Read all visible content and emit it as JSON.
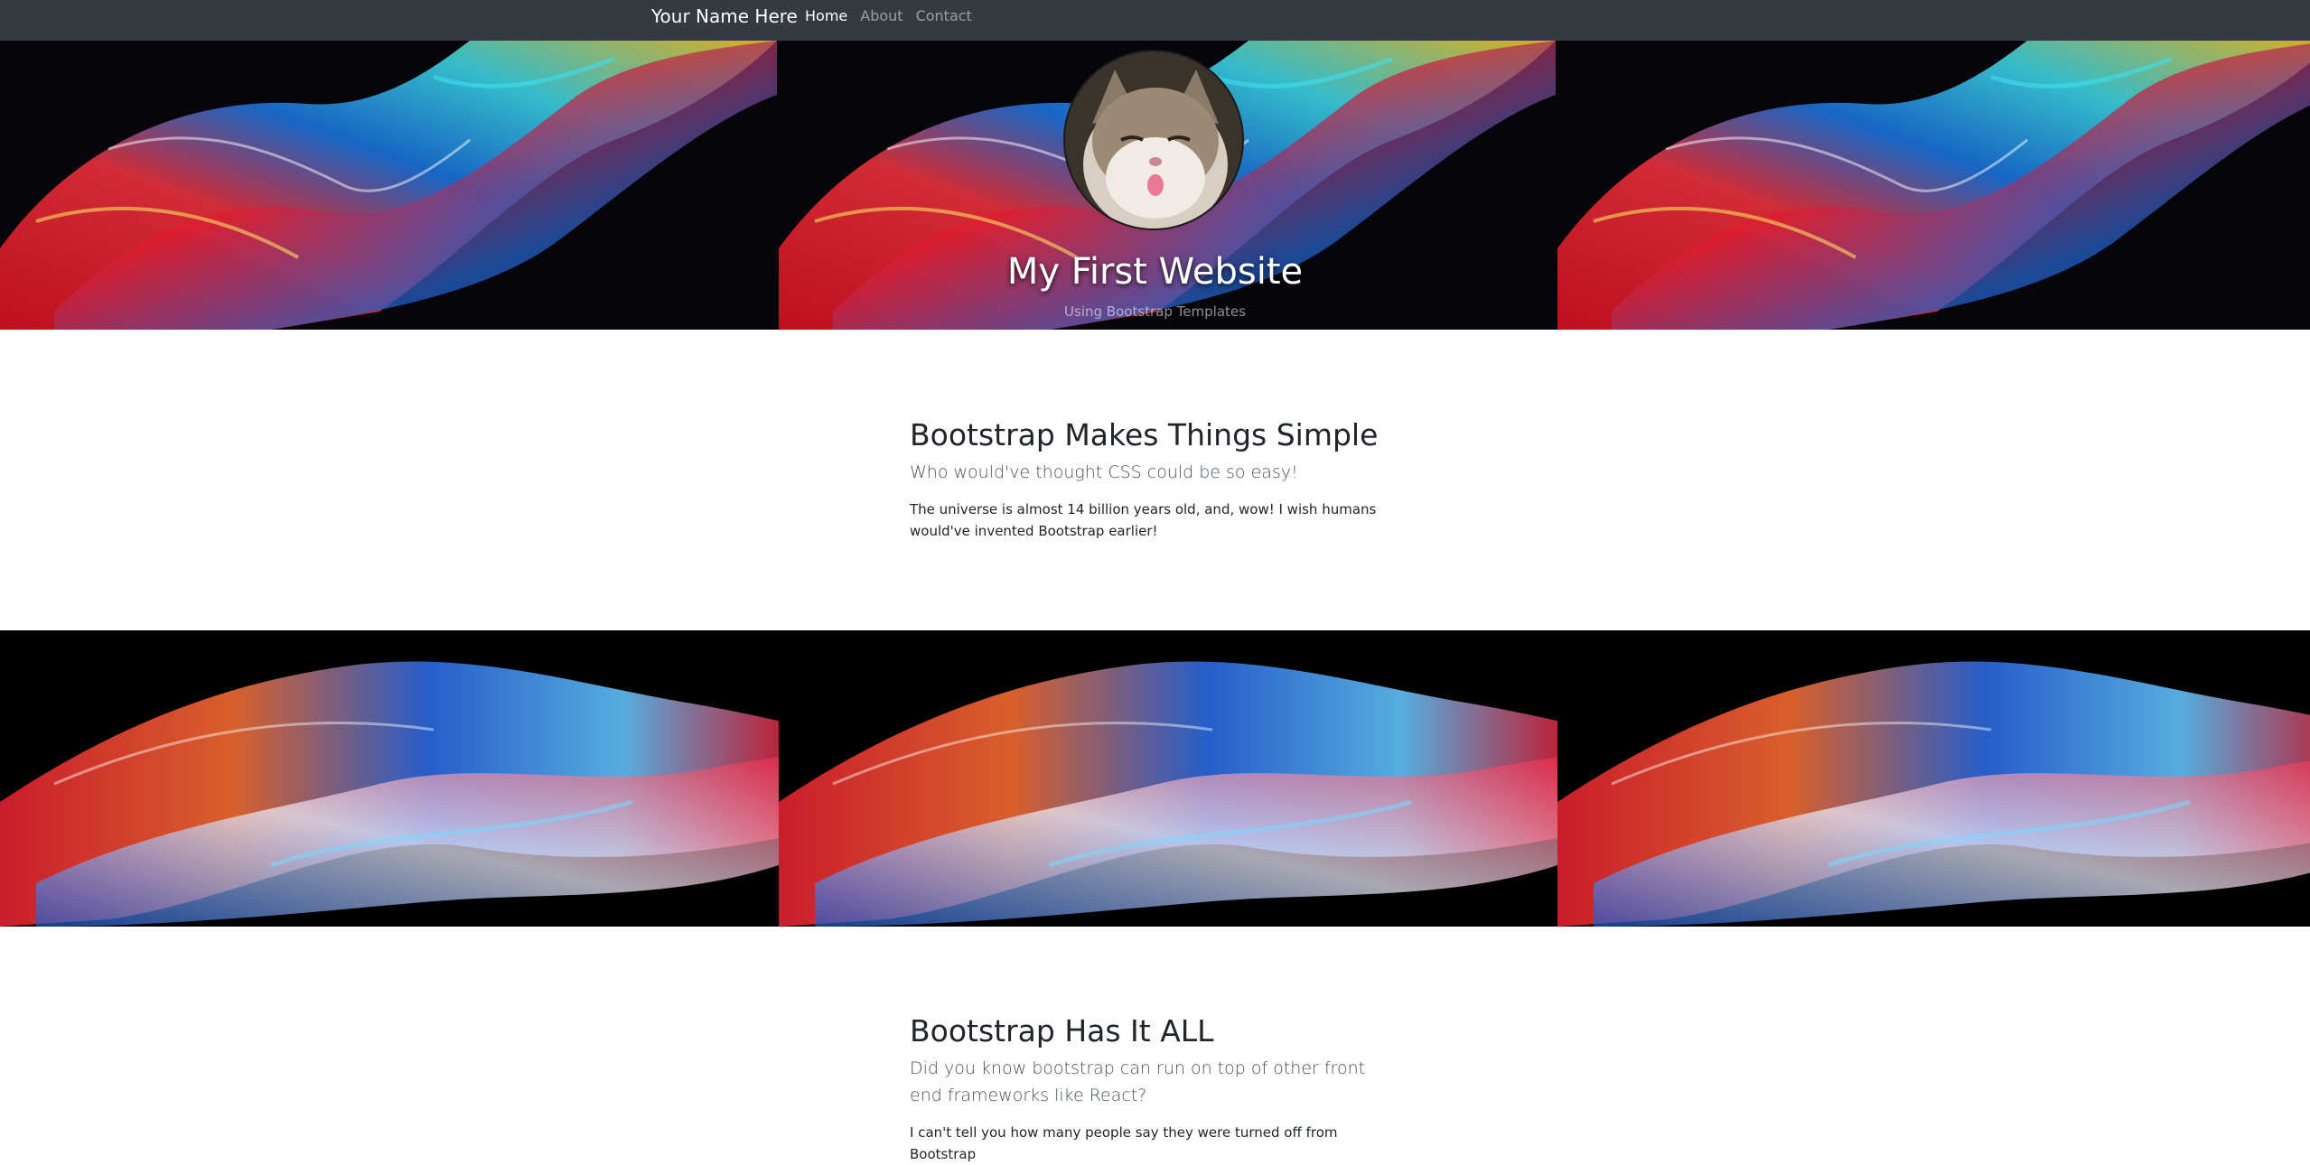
{
  "navbar": {
    "brand": "Your Name Here",
    "links": [
      {
        "label": "Home",
        "active": true
      },
      {
        "label": "About",
        "active": false
      },
      {
        "label": "Contact",
        "active": false
      }
    ]
  },
  "hero": {
    "title": "My First Website",
    "subtitle": "Using Bootstrap Templates"
  },
  "section1": {
    "heading": "Bootstrap Makes Things Simple",
    "lead": "Who would've thought CSS could be so easy!",
    "body": "The universe is almost 14 billion years old, and, wow! I wish humans would've invented Bootstrap earlier!"
  },
  "section2": {
    "heading": "Bootstrap Has It ALL",
    "lead": "Did you know bootstrap can run on top of other front end frameworks like React?",
    "body": "I can't tell you how many people say they were turned off from Bootstrap"
  },
  "colors": {
    "navbar_bg": "#343a40",
    "hero_bg": "#05050a",
    "text_dark": "#212529"
  }
}
